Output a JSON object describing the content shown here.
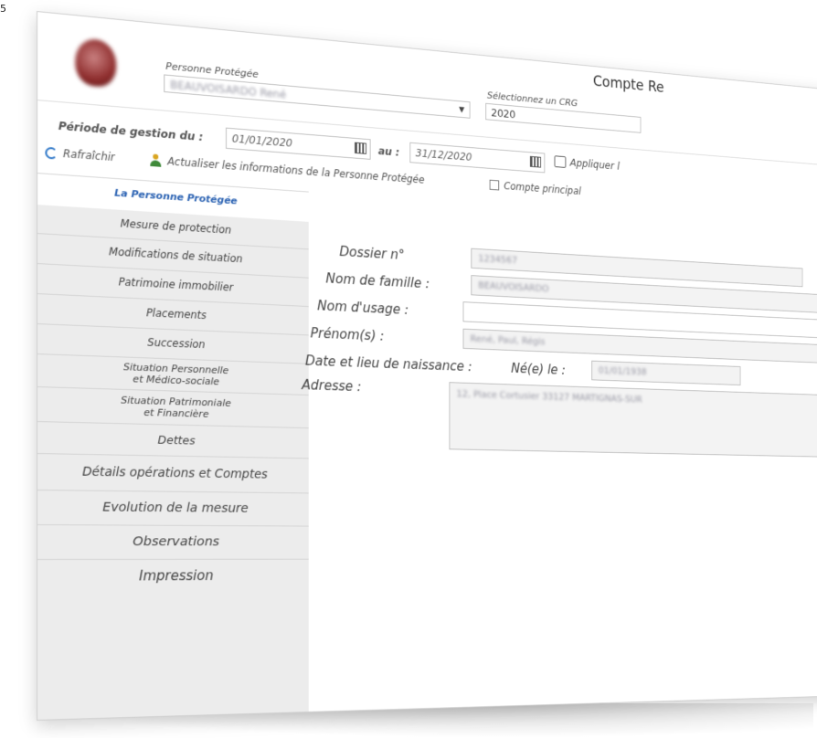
{
  "corner_mark": "5",
  "header": {
    "title": "Compte Re",
    "protected_person_label": "Personne Protégée",
    "protected_person_value": "BEAUVOISARDO René",
    "crg_label": "Sélectionnez un CRG",
    "crg_value": "2020"
  },
  "period": {
    "label": "Période de gestion du :",
    "from": "01/01/2020",
    "to_label": "au :",
    "to": "31/12/2020",
    "apply_label": "Appliquer l"
  },
  "toolbar": {
    "refresh_label": "Rafraîchir",
    "update_label": "Actualiser les informations de la Personne Protégée",
    "main_account_label": "Compte principal"
  },
  "sidebar": {
    "tabs": [
      {
        "label": "La Personne Protégée"
      },
      {
        "label": "Mesure de protection"
      },
      {
        "label": "Modifications de situation"
      },
      {
        "label": "Patrimoine immobilier"
      },
      {
        "label": "Placements"
      },
      {
        "label": "Succession"
      },
      {
        "label": "Situation Personnelle\net Médico-sociale"
      },
      {
        "label": "Situation Patrimoniale\net Financière"
      },
      {
        "label": "Dettes"
      },
      {
        "label": "Détails opérations et Comptes"
      },
      {
        "label": "Evolution de la mesure"
      },
      {
        "label": "Observations"
      },
      {
        "label": "Impression"
      }
    ]
  },
  "form": {
    "dossier_label": "Dossier n°",
    "dossier_value": "1234567",
    "family_name_label": "Nom de famille :",
    "family_name_value": "BEAUVOISARDO",
    "usage_name_label": "Nom d'usage :",
    "usage_name_value": "",
    "first_names_label": "Prénom(s) :",
    "first_names_value": "René, Paul, Régis",
    "birth_label": "Date et lieu de naissance :",
    "born_on_label": "Né(e) le :",
    "born_on_value": "01/01/1938",
    "address_label": "Adresse :",
    "address_value": "12, Place Cortusier 33127 MARTIGNAS-SUR"
  }
}
